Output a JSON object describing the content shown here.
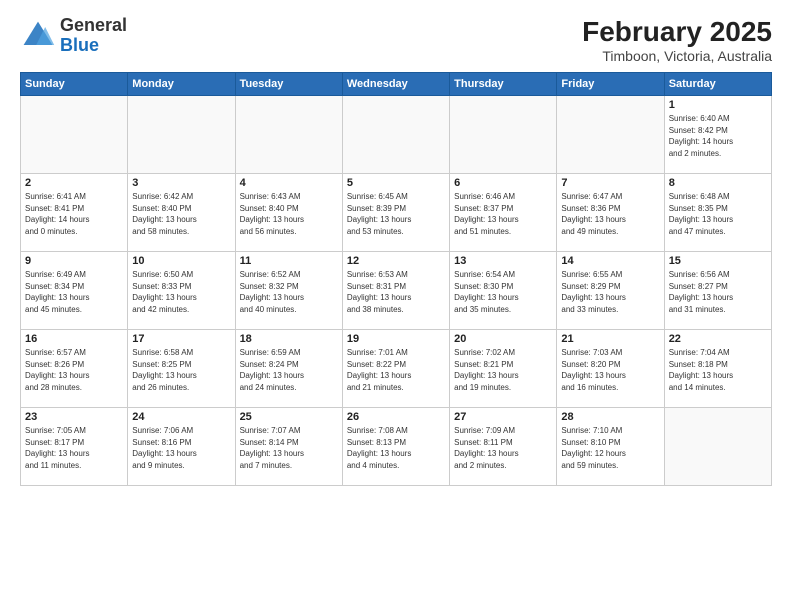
{
  "header": {
    "logo": {
      "general": "General",
      "blue": "Blue"
    },
    "title": "February 2025",
    "subtitle": "Timboon, Victoria, Australia"
  },
  "days_of_week": [
    "Sunday",
    "Monday",
    "Tuesday",
    "Wednesday",
    "Thursday",
    "Friday",
    "Saturday"
  ],
  "weeks": [
    [
      {
        "day": "",
        "info": ""
      },
      {
        "day": "",
        "info": ""
      },
      {
        "day": "",
        "info": ""
      },
      {
        "day": "",
        "info": ""
      },
      {
        "day": "",
        "info": ""
      },
      {
        "day": "",
        "info": ""
      },
      {
        "day": "1",
        "info": "Sunrise: 6:40 AM\nSunset: 8:42 PM\nDaylight: 14 hours\nand 2 minutes."
      }
    ],
    [
      {
        "day": "2",
        "info": "Sunrise: 6:41 AM\nSunset: 8:41 PM\nDaylight: 14 hours\nand 0 minutes."
      },
      {
        "day": "3",
        "info": "Sunrise: 6:42 AM\nSunset: 8:40 PM\nDaylight: 13 hours\nand 58 minutes."
      },
      {
        "day": "4",
        "info": "Sunrise: 6:43 AM\nSunset: 8:40 PM\nDaylight: 13 hours\nand 56 minutes."
      },
      {
        "day": "5",
        "info": "Sunrise: 6:45 AM\nSunset: 8:39 PM\nDaylight: 13 hours\nand 53 minutes."
      },
      {
        "day": "6",
        "info": "Sunrise: 6:46 AM\nSunset: 8:37 PM\nDaylight: 13 hours\nand 51 minutes."
      },
      {
        "day": "7",
        "info": "Sunrise: 6:47 AM\nSunset: 8:36 PM\nDaylight: 13 hours\nand 49 minutes."
      },
      {
        "day": "8",
        "info": "Sunrise: 6:48 AM\nSunset: 8:35 PM\nDaylight: 13 hours\nand 47 minutes."
      }
    ],
    [
      {
        "day": "9",
        "info": "Sunrise: 6:49 AM\nSunset: 8:34 PM\nDaylight: 13 hours\nand 45 minutes."
      },
      {
        "day": "10",
        "info": "Sunrise: 6:50 AM\nSunset: 8:33 PM\nDaylight: 13 hours\nand 42 minutes."
      },
      {
        "day": "11",
        "info": "Sunrise: 6:52 AM\nSunset: 8:32 PM\nDaylight: 13 hours\nand 40 minutes."
      },
      {
        "day": "12",
        "info": "Sunrise: 6:53 AM\nSunset: 8:31 PM\nDaylight: 13 hours\nand 38 minutes."
      },
      {
        "day": "13",
        "info": "Sunrise: 6:54 AM\nSunset: 8:30 PM\nDaylight: 13 hours\nand 35 minutes."
      },
      {
        "day": "14",
        "info": "Sunrise: 6:55 AM\nSunset: 8:29 PM\nDaylight: 13 hours\nand 33 minutes."
      },
      {
        "day": "15",
        "info": "Sunrise: 6:56 AM\nSunset: 8:27 PM\nDaylight: 13 hours\nand 31 minutes."
      }
    ],
    [
      {
        "day": "16",
        "info": "Sunrise: 6:57 AM\nSunset: 8:26 PM\nDaylight: 13 hours\nand 28 minutes."
      },
      {
        "day": "17",
        "info": "Sunrise: 6:58 AM\nSunset: 8:25 PM\nDaylight: 13 hours\nand 26 minutes."
      },
      {
        "day": "18",
        "info": "Sunrise: 6:59 AM\nSunset: 8:24 PM\nDaylight: 13 hours\nand 24 minutes."
      },
      {
        "day": "19",
        "info": "Sunrise: 7:01 AM\nSunset: 8:22 PM\nDaylight: 13 hours\nand 21 minutes."
      },
      {
        "day": "20",
        "info": "Sunrise: 7:02 AM\nSunset: 8:21 PM\nDaylight: 13 hours\nand 19 minutes."
      },
      {
        "day": "21",
        "info": "Sunrise: 7:03 AM\nSunset: 8:20 PM\nDaylight: 13 hours\nand 16 minutes."
      },
      {
        "day": "22",
        "info": "Sunrise: 7:04 AM\nSunset: 8:18 PM\nDaylight: 13 hours\nand 14 minutes."
      }
    ],
    [
      {
        "day": "23",
        "info": "Sunrise: 7:05 AM\nSunset: 8:17 PM\nDaylight: 13 hours\nand 11 minutes."
      },
      {
        "day": "24",
        "info": "Sunrise: 7:06 AM\nSunset: 8:16 PM\nDaylight: 13 hours\nand 9 minutes."
      },
      {
        "day": "25",
        "info": "Sunrise: 7:07 AM\nSunset: 8:14 PM\nDaylight: 13 hours\nand 7 minutes."
      },
      {
        "day": "26",
        "info": "Sunrise: 7:08 AM\nSunset: 8:13 PM\nDaylight: 13 hours\nand 4 minutes."
      },
      {
        "day": "27",
        "info": "Sunrise: 7:09 AM\nSunset: 8:11 PM\nDaylight: 13 hours\nand 2 minutes."
      },
      {
        "day": "28",
        "info": "Sunrise: 7:10 AM\nSunset: 8:10 PM\nDaylight: 12 hours\nand 59 minutes."
      },
      {
        "day": "",
        "info": ""
      }
    ]
  ]
}
